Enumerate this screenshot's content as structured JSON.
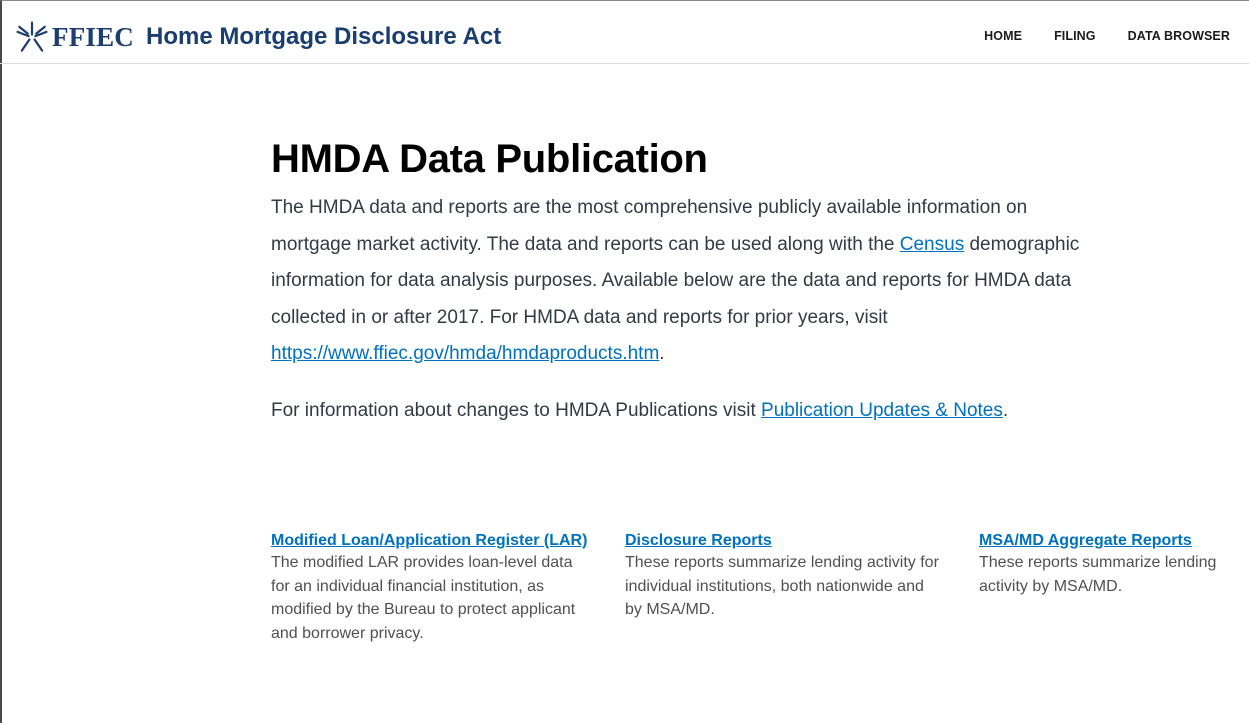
{
  "header": {
    "brand_short": "FFIEC",
    "brand_title": "Home Mortgage Disclosure Act",
    "nav": [
      {
        "label": "HOME"
      },
      {
        "label": "FILING"
      },
      {
        "label": "DATA BROWSER"
      }
    ]
  },
  "main": {
    "title": "HMDA Data Publication",
    "intro_part1": "The HMDA data and reports are the most comprehensive publicly available information on mortgage market activity. The data and reports can be used along with the ",
    "intro_link_census": "Census",
    "intro_part2": " demographic information for data analysis purposes. Available below are the data and reports for HMDA data collected in or after 2017. For HMDA data and reports for prior years, visit ",
    "intro_link_products": "https://www.ffiec.gov/hmda/hmdaproducts.htm",
    "intro_part3": ".",
    "updates_prefix": "For information about changes to HMDA Publications visit ",
    "updates_link": "Publication Updates & Notes",
    "updates_suffix": "."
  },
  "cards": [
    {
      "title": "Modified Loan/Application Register (LAR)",
      "description": "The modified LAR provides loan-level data for an individual financial institution, as modified by the Bureau to protect applicant and borrower privacy."
    },
    {
      "title": "Disclosure Reports",
      "description": "These reports summarize lending activity for individual institutions, both nationwide and by MSA/MD."
    },
    {
      "title": "MSA/MD Aggregate Reports",
      "description": "These reports summarize lending activity by MSA/MD."
    }
  ],
  "colors": {
    "brand": "#1a3e6f",
    "link": "#0071bc",
    "text": "#323a45"
  },
  "icons": {
    "brand": "ffiec-star-icon"
  }
}
